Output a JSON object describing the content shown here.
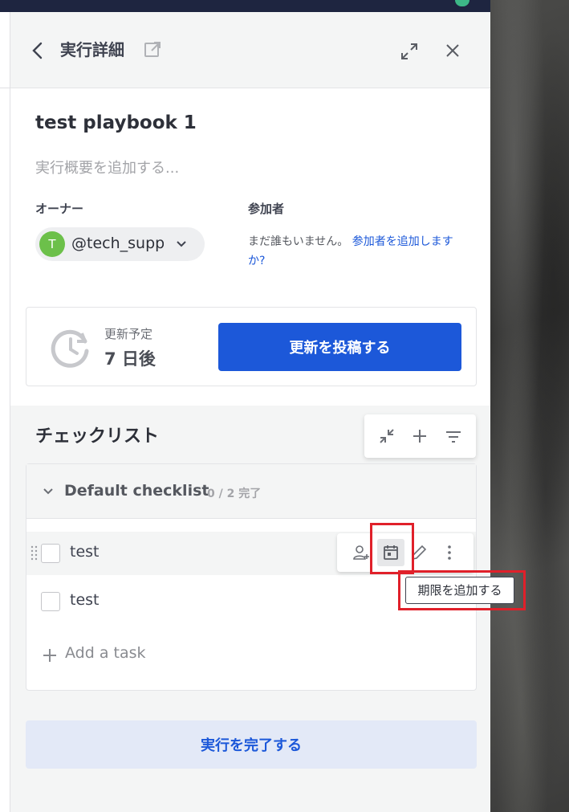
{
  "header": {
    "title": "実行詳細"
  },
  "run": {
    "title": "test playbook 1",
    "summary_placeholder": "実行概要を追加する..."
  },
  "owner": {
    "label": "オーナー",
    "avatar_initial": "T",
    "name": "@tech_support",
    "avatar_color": "#6cc04a"
  },
  "participants": {
    "label": "参加者",
    "empty_text": "まだ誰もいません。",
    "add_link": "参加者を追加しますか?"
  },
  "update": {
    "label": "更新予定",
    "value": "7 日後",
    "post_button": "更新を投稿する"
  },
  "checklist": {
    "title": "チェックリスト",
    "name": "Default checklist",
    "progress": "0 / 2 完了",
    "tasks": [
      {
        "label": "test"
      },
      {
        "label": "test"
      }
    ],
    "add_task": "Add a task"
  },
  "tooltip": {
    "text": "期限を追加する"
  },
  "footer": {
    "finish_button": "実行を完了する"
  },
  "colors": {
    "accent": "#1c58d9",
    "highlight": "#e0202a",
    "topbar": "#1e2540"
  }
}
